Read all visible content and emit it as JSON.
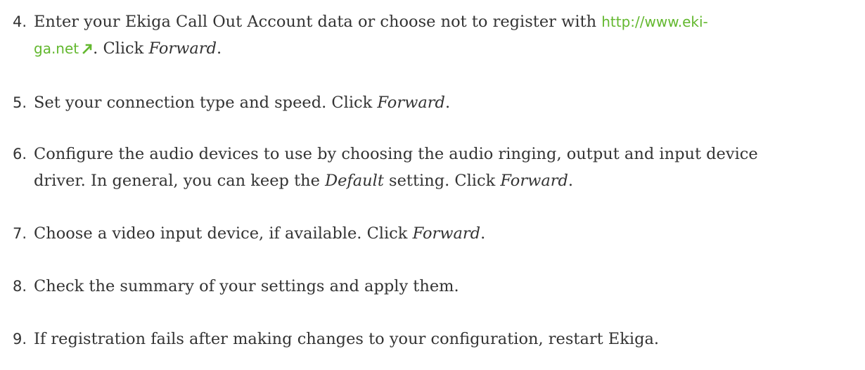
{
  "steps": [
    {
      "number": "4.",
      "text_before": "Enter your Ekiga Call Out Account data or choose not to register with ",
      "link_line1": "http://www.eki-",
      "link_line2": "ga.net",
      "text_after": ". Click ",
      "emphasis": "Forward",
      "end": "."
    },
    {
      "number": "5.",
      "text": "Set your connection type and speed. Click ",
      "emphasis": "Forward",
      "end": "."
    },
    {
      "number": "6.",
      "line1": "Configure the audio devices to use by choosing the audio ringing, output and input device",
      "line2_before": "driver. In general, you can keep the ",
      "emphasis1": "Default",
      "line2_middle": " setting. Click ",
      "emphasis2": "Forward",
      "end": "."
    },
    {
      "number": "7.",
      "text": "Choose a video input device, if available. Click ",
      "emphasis": "Forward",
      "end": "."
    },
    {
      "number": "8.",
      "text": "Check the summary of your settings and apply them."
    },
    {
      "number": "9.",
      "text": "If registration fails after making changes to your configuration, restart Ekiga."
    }
  ],
  "colors": {
    "text": "#333333",
    "link": "#63b82f"
  },
  "icons": {
    "external_link": "external-link-icon"
  }
}
